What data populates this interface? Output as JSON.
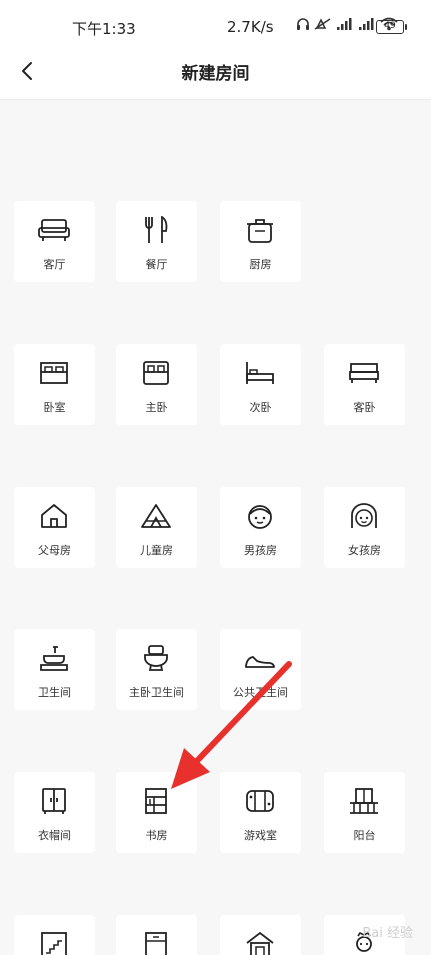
{
  "status_bar": {
    "time": "下午1:33",
    "net_speed": "2.7K/s",
    "battery": "49"
  },
  "header": {
    "title": "新建房间"
  },
  "sections": [
    {
      "rooms": [
        {
          "label": "客厅",
          "icon": "sofa-icon"
        },
        {
          "label": "餐厅",
          "icon": "fork-knife-icon"
        },
        {
          "label": "厨房",
          "icon": "pot-icon"
        }
      ]
    },
    {
      "rooms": [
        {
          "label": "卧室",
          "icon": "bed-icon"
        },
        {
          "label": "主卧",
          "icon": "master-bed-icon"
        },
        {
          "label": "次卧",
          "icon": "single-bed-icon"
        },
        {
          "label": "客卧",
          "icon": "guest-bed-icon"
        }
      ]
    },
    {
      "rooms": [
        {
          "label": "父母房",
          "icon": "house-icon"
        },
        {
          "label": "儿童房",
          "icon": "tent-icon"
        },
        {
          "label": "男孩房",
          "icon": "boy-face-icon"
        },
        {
          "label": "女孩房",
          "icon": "girl-face-icon"
        }
      ]
    },
    {
      "rooms": [
        {
          "label": "卫生间",
          "icon": "sink-icon"
        },
        {
          "label": "主卧卫生间",
          "icon": "toilet-icon"
        },
        {
          "label": "公共卫生间",
          "icon": "slipper-icon"
        }
      ]
    },
    {
      "rooms": [
        {
          "label": "衣帽间",
          "icon": "wardrobe-icon"
        },
        {
          "label": "书房",
          "icon": "bookshelf-icon"
        },
        {
          "label": "游戏室",
          "icon": "game-console-icon"
        },
        {
          "label": "阳台",
          "icon": "balcony-icon"
        }
      ]
    },
    {
      "rooms": [
        {
          "label": "",
          "icon": "stairs-icon"
        },
        {
          "label": "",
          "icon": "cabinet-icon"
        },
        {
          "label": "",
          "icon": "home-icon"
        },
        {
          "label": "",
          "icon": "maid-icon"
        }
      ]
    }
  ],
  "annotation": {
    "arrow_color": "#e8302c"
  },
  "watermark": "Bai 经验"
}
